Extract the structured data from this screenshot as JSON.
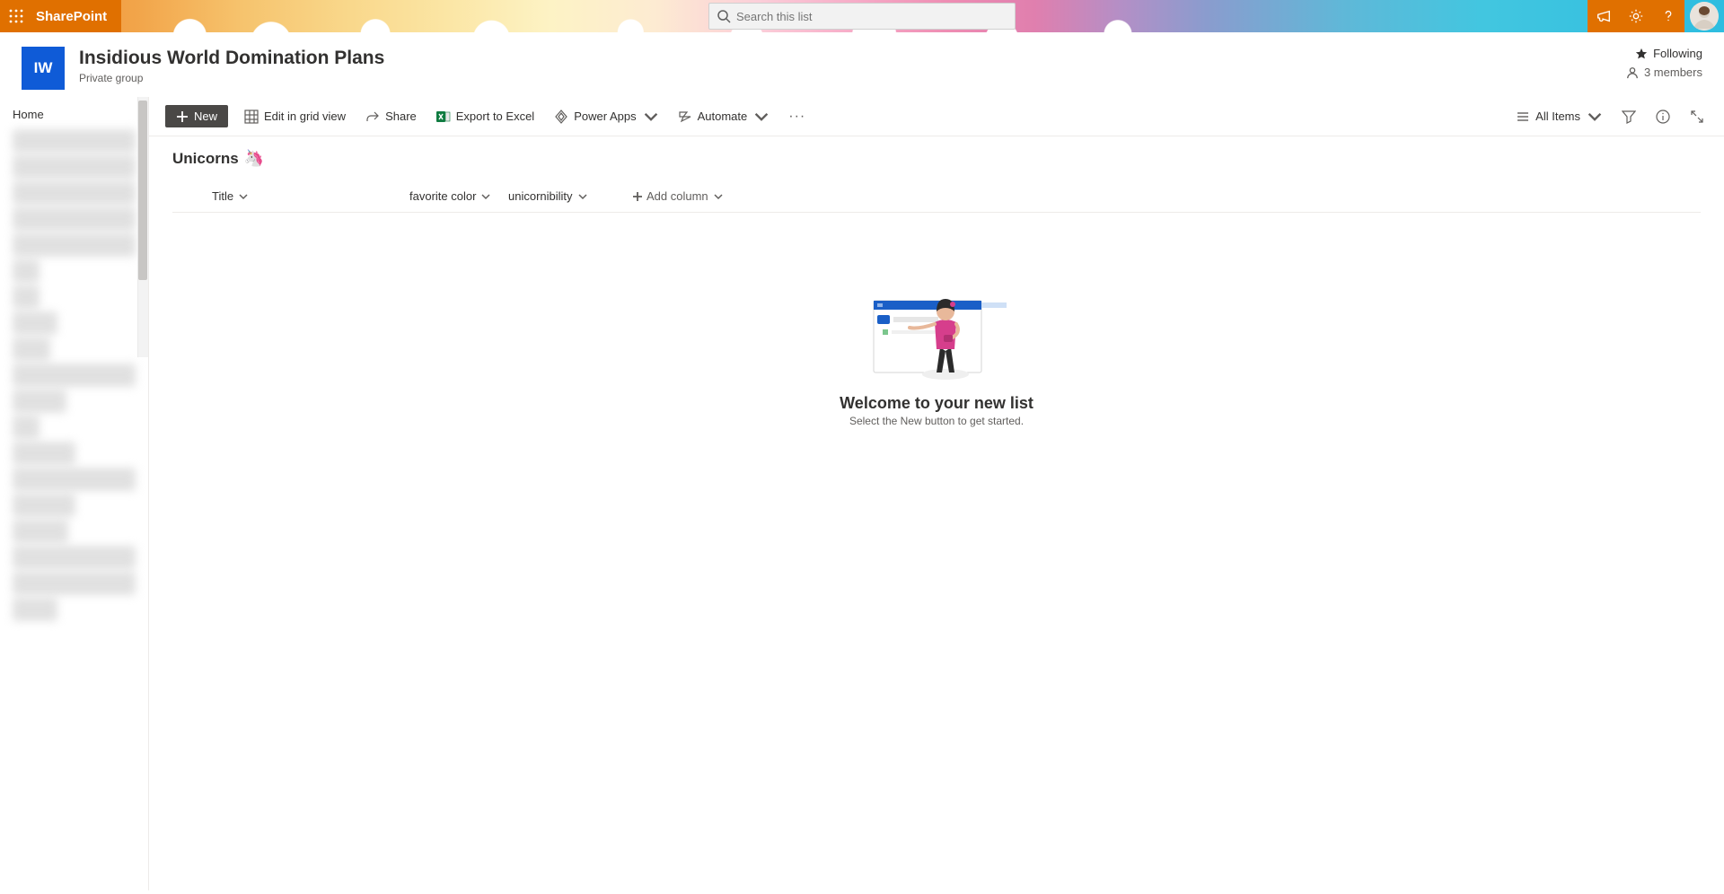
{
  "app": {
    "brand": "SharePoint"
  },
  "search": {
    "placeholder": "Search this list"
  },
  "site": {
    "logo_initials": "IW",
    "title": "Insidious World Domination Plans",
    "subtitle": "Private group",
    "following_label": "Following",
    "members_label": "3 members"
  },
  "left_nav": {
    "home": "Home"
  },
  "commands": {
    "new": "New",
    "edit_grid": "Edit in grid view",
    "share": "Share",
    "export_excel": "Export to Excel",
    "power_apps": "Power Apps",
    "automate": "Automate",
    "all_items": "All Items"
  },
  "list": {
    "title": "Unicorns",
    "emoji": "🦄",
    "columns": {
      "title": "Title",
      "favorite_color": "favorite color",
      "unicornibility": "unicornibility",
      "add_column": "Add column"
    }
  },
  "empty_state": {
    "title": "Welcome to your new list",
    "subtitle": "Select the New button to get started."
  }
}
